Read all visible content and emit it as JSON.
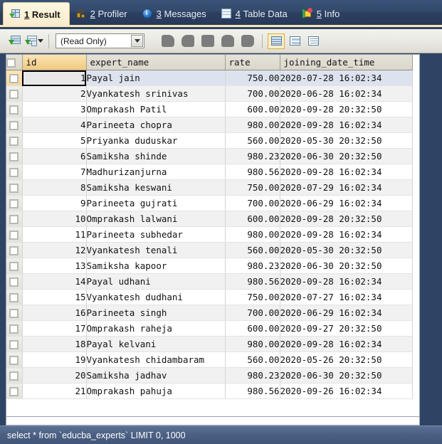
{
  "tabs": [
    {
      "num": "1",
      "label": "Result",
      "icon": "result-grid-icon",
      "active": true
    },
    {
      "num": "2",
      "label": "Profiler",
      "icon": "profiler-icon",
      "active": false
    },
    {
      "num": "3",
      "label": "Messages",
      "icon": "info-circle-icon",
      "active": false
    },
    {
      "num": "4",
      "label": "Table Data",
      "icon": "table-icon",
      "active": false
    },
    {
      "num": "5",
      "label": "Info",
      "icon": "info-tag-icon",
      "active": false
    }
  ],
  "toolbar": {
    "export_grid_title": "export-resultset",
    "export_grid2_title": "export-resultset-options",
    "mode_value": "(Read Only)",
    "actions": [
      "apply-changes",
      "revert-changes",
      "stop-edit",
      "commit",
      "rollback"
    ],
    "views": [
      {
        "name": "grid-view",
        "selected": true
      },
      {
        "name": "form-view",
        "selected": false
      },
      {
        "name": "text-view",
        "selected": false
      }
    ]
  },
  "grid": {
    "columns": [
      "id",
      "expert_name",
      "rate",
      "joining_date_time"
    ],
    "active_column": "id",
    "selected_row": 1,
    "rows": [
      {
        "id": "1",
        "expert_name": "Payal jain",
        "rate": "750.00",
        "joining_date_time": "2020-07-28 16:02:34"
      },
      {
        "id": "2",
        "expert_name": "Vyankatesh srinivas",
        "rate": "700.00",
        "joining_date_time": "2020-06-28 16:02:34"
      },
      {
        "id": "3",
        "expert_name": "Omprakash Patil",
        "rate": "600.00",
        "joining_date_time": "2020-09-28 20:32:50"
      },
      {
        "id": "4",
        "expert_name": "Parineeta chopra",
        "rate": "980.00",
        "joining_date_time": "2020-09-28 16:02:34"
      },
      {
        "id": "5",
        "expert_name": "Priyanka duduskar",
        "rate": "560.00",
        "joining_date_time": "2020-05-30 20:32:50"
      },
      {
        "id": "6",
        "expert_name": "Samiksha shinde",
        "rate": "980.23",
        "joining_date_time": "2020-06-30 20:32:50"
      },
      {
        "id": "7",
        "expert_name": "Madhurizanjurna",
        "rate": "980.56",
        "joining_date_time": "2020-09-28 16:02:34"
      },
      {
        "id": "8",
        "expert_name": "Samiksha keswani",
        "rate": "750.00",
        "joining_date_time": "2020-07-29 16:02:34"
      },
      {
        "id": "9",
        "expert_name": "Parineeta gujrati",
        "rate": "700.00",
        "joining_date_time": "2020-06-29 16:02:34"
      },
      {
        "id": "10",
        "expert_name": "Omprakash lalwani",
        "rate": "600.00",
        "joining_date_time": "2020-09-28 20:32:50"
      },
      {
        "id": "11",
        "expert_name": "Parineeta subhedar",
        "rate": "980.00",
        "joining_date_time": "2020-09-28 16:02:34"
      },
      {
        "id": "12",
        "expert_name": "Vyankatesh tenali",
        "rate": "560.00",
        "joining_date_time": "2020-05-30 20:32:50"
      },
      {
        "id": "13",
        "expert_name": "Samiksha kapoor",
        "rate": "980.23",
        "joining_date_time": "2020-06-30 20:32:50"
      },
      {
        "id": "14",
        "expert_name": "Payal udhani",
        "rate": "980.56",
        "joining_date_time": "2020-09-28 16:02:34"
      },
      {
        "id": "15",
        "expert_name": "Vyankatesh dudhani",
        "rate": "750.00",
        "joining_date_time": "2020-07-27 16:02:34"
      },
      {
        "id": "16",
        "expert_name": "Parineeta singh",
        "rate": "700.00",
        "joining_date_time": "2020-06-29 16:02:34"
      },
      {
        "id": "17",
        "expert_name": "Omprakash raheja",
        "rate": "600.00",
        "joining_date_time": "2020-09-27 20:32:50"
      },
      {
        "id": "18",
        "expert_name": "Payal kelvani",
        "rate": "980.00",
        "joining_date_time": "2020-09-28 16:02:34"
      },
      {
        "id": "19",
        "expert_name": "Vyankatesh chidambaram",
        "rate": "560.00",
        "joining_date_time": "2020-05-26 20:32:50"
      },
      {
        "id": "20",
        "expert_name": "Samiksha jadhav",
        "rate": "980.23",
        "joining_date_time": "2020-06-30 20:32:50"
      },
      {
        "id": "21",
        "expert_name": "Omprakash pahuja",
        "rate": "980.56",
        "joining_date_time": "2020-09-26 16:02:34"
      }
    ]
  },
  "statusbar": {
    "query": "select * from `educba_experts` LIMIT 0, 1000"
  },
  "colors": {
    "tabbar_bg": "#2e4465",
    "active_tab_bg": "#fbf0d2",
    "accent_underline": "#f6e7b4",
    "toolbar_bg": "#e9e9e2",
    "header_bg": "#dbd7cb",
    "header_active_bg": "#f6d79a",
    "row_alt_bg": "#f1f1f1",
    "selected_row_bg": "#dde3ee",
    "statusbar_bg": "#4b5f83"
  }
}
